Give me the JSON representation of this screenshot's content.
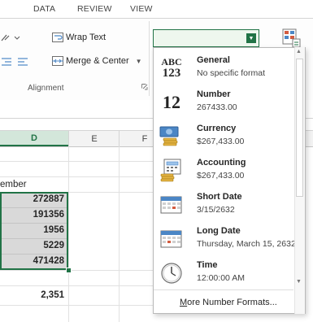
{
  "ribbon": {
    "tabs": [
      "DATA",
      "REVIEW",
      "VIEW"
    ],
    "wrap_text": "Wrap Text",
    "merge_center": "Merge & Center",
    "alignment_label": "Alignment"
  },
  "grid": {
    "columns": [
      "D",
      "E",
      "F"
    ],
    "d_header_partial": "ember",
    "values": [
      "272887",
      "191356",
      "1956",
      "5229",
      "471428"
    ],
    "total": "2,351"
  },
  "number_format": {
    "selected": "",
    "items": [
      {
        "title": "General",
        "sub": "No specific format",
        "icon": "general-icon",
        "glyph": "ABC\n123"
      },
      {
        "title": "Number",
        "sub": "267433.00",
        "icon": "number-icon",
        "glyph": "12"
      },
      {
        "title": "Currency",
        "sub": "$267,433.00",
        "icon": "currency-icon"
      },
      {
        "title": "Accounting",
        "sub": "$267,433.00",
        "icon": "accounting-icon"
      },
      {
        "title": "Short Date",
        "sub": "3/15/2632",
        "icon": "short-date-icon"
      },
      {
        "title": "Long Date",
        "sub": "Thursday, March 15, 2632",
        "icon": "long-date-icon"
      },
      {
        "title": "Time",
        "sub": "12:00:00 AM",
        "icon": "clock-icon"
      }
    ],
    "more": "More Number Formats...",
    "more_accel": "M",
    "more_rest": "ore Number Formats..."
  },
  "colors": {
    "excel_green": "#217346",
    "selection_gray": "#d9d9d9"
  }
}
